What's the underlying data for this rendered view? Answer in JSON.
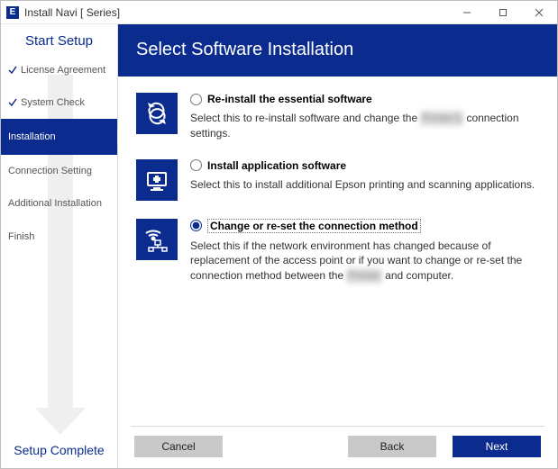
{
  "window": {
    "icon_letter": "E",
    "title": "Install Navi [        Series]"
  },
  "sidebar": {
    "start": "Start Setup",
    "complete": "Setup Complete",
    "steps": [
      {
        "label": "License Agreement",
        "done": true,
        "active": false
      },
      {
        "label": "System Check",
        "done": true,
        "active": false
      },
      {
        "label": "Installation",
        "done": false,
        "active": true
      },
      {
        "label": "Connection Setting",
        "done": false,
        "active": false
      },
      {
        "label": "Additional Installation",
        "done": false,
        "active": false
      },
      {
        "label": "Finish",
        "done": false,
        "active": false
      }
    ]
  },
  "header": "Select Software Installation",
  "options": [
    {
      "id": "reinstall",
      "title": "Re-install the essential software",
      "desc_pre": "Select this to re-install software and change the ",
      "desc_blur": "Printer's",
      "desc_post": " connection settings.",
      "selected": false
    },
    {
      "id": "install-app",
      "title": "Install application software",
      "desc_pre": "Select this to install additional Epson printing and scanning applications.",
      "desc_blur": "",
      "desc_post": "",
      "selected": false
    },
    {
      "id": "change-conn",
      "title": "Change or re-set the connection method",
      "desc_pre": "Select this if the network environment has changed because of replacement of the access point or if you want to change or re-set the connection method between the ",
      "desc_blur": "Printer",
      "desc_post": " and computer.",
      "selected": true
    }
  ],
  "buttons": {
    "cancel": "Cancel",
    "back": "Back",
    "next": "Next"
  }
}
